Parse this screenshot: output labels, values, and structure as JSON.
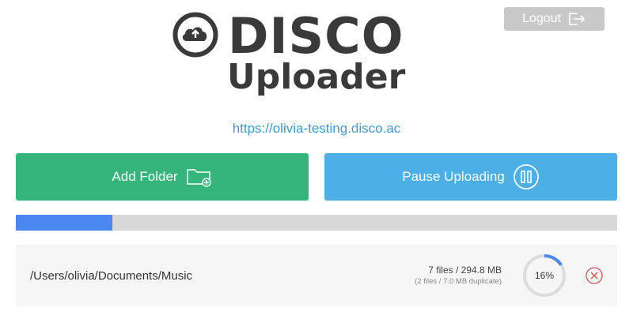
{
  "header": {
    "logout_label": "Logout",
    "logo_title": "DISCO",
    "logo_subtitle": "Uploader",
    "site_url": "https://olivia-testing.disco.ac"
  },
  "actions": {
    "add_folder_label": "Add Folder",
    "pause_label": "Pause Uploading"
  },
  "overall_progress": 0.16,
  "upload": {
    "path": "/Users/olivia/Documents/Music",
    "file_summary": "7 files / 294.8 MB",
    "duplicate_summary": "(2 files / 7.0 MB duplicate)",
    "percent_label": "16%",
    "progress": 0.16
  },
  "colors": {
    "add_button": "#35b57c",
    "pause_button": "#4cb0e6",
    "progress_fill": "#4a87ee",
    "link": "#3a9bd6",
    "cancel": "#d9534f"
  },
  "icons": {
    "logout": "logout-icon",
    "logo": "cloud-upload-icon",
    "add_folder": "folder-add-icon",
    "pause": "pause-circle-icon",
    "cancel": "close-circle-icon"
  }
}
